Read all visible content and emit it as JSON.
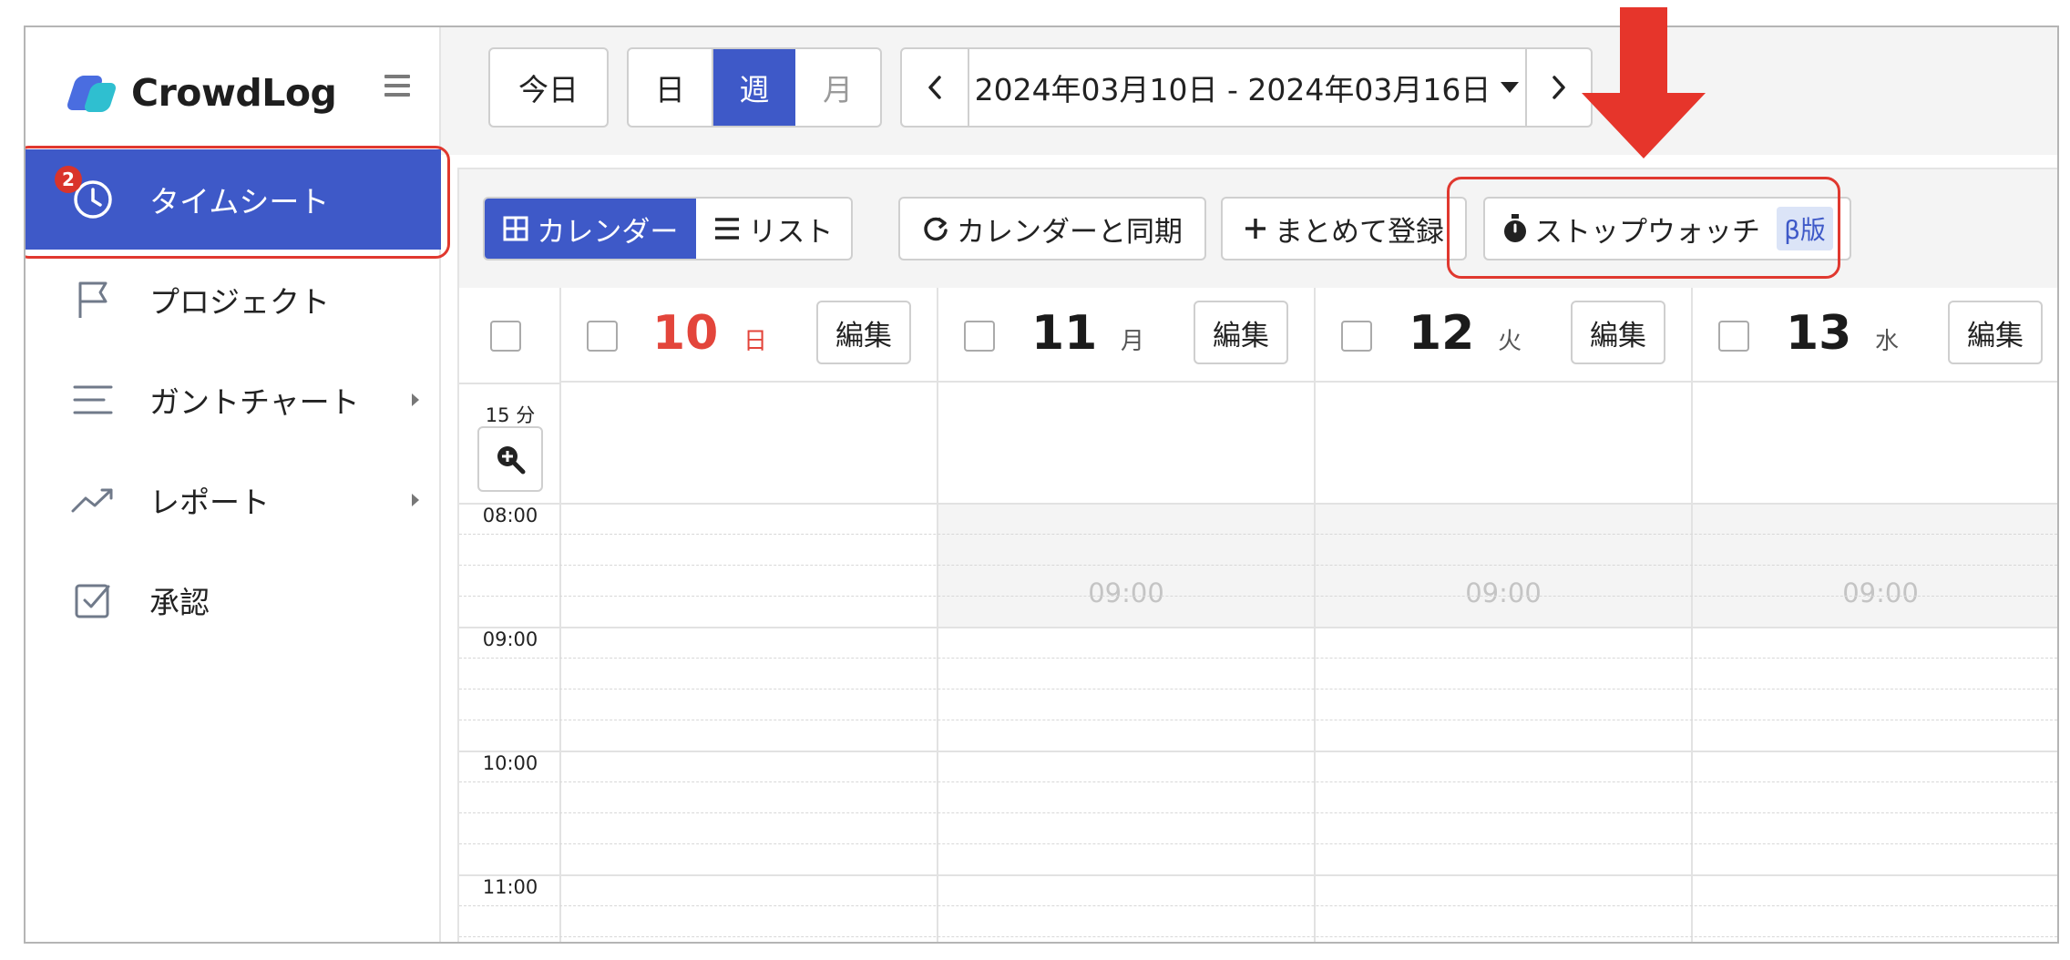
{
  "app": {
    "logo_text": "CrowdLog"
  },
  "sidebar": {
    "items": [
      {
        "label": "タイムシート",
        "icon": "clock-icon",
        "active": true,
        "badge": "2"
      },
      {
        "label": "プロジェクト",
        "icon": "flag-icon"
      },
      {
        "label": "ガントチャート",
        "icon": "gantt-lines-icon",
        "has_submenu": true
      },
      {
        "label": "レポート",
        "icon": "trend-icon",
        "has_submenu": true
      },
      {
        "label": "承認",
        "icon": "checkbox-icon"
      }
    ]
  },
  "topbar": {
    "today_label": "今日",
    "view_modes": [
      "日",
      "週",
      "月"
    ],
    "selected_view": "週",
    "prev_label": "‹",
    "date_range": "2024年03月10日 - 2024年03月16日",
    "next_label": "›"
  },
  "toolbar": {
    "calendar_label": "カレンダー",
    "list_label": "リスト",
    "sync_label": "カレンダーと同期",
    "bulk_add_label": "まとめて登録",
    "stopwatch_label": "ストップウォッチ",
    "stopwatch_badge": "β版"
  },
  "calendar": {
    "interval": "15 分",
    "edit_label": "編集",
    "days": [
      {
        "num": "10",
        "dow": "日",
        "color": "#e3453b"
      },
      {
        "num": "11",
        "dow": "月",
        "color": "#1b1b1b"
      },
      {
        "num": "12",
        "dow": "火",
        "color": "#1b1b1b"
      },
      {
        "num": "13",
        "dow": "水",
        "color": "#1b1b1b"
      }
    ],
    "times": [
      "08:00",
      "09:00",
      "10:00",
      "11:00"
    ],
    "work_start_label": "09:00"
  },
  "colors": {
    "accent": "#3e59c8",
    "highlight": "#e0382f",
    "sunday": "#e3453b"
  }
}
